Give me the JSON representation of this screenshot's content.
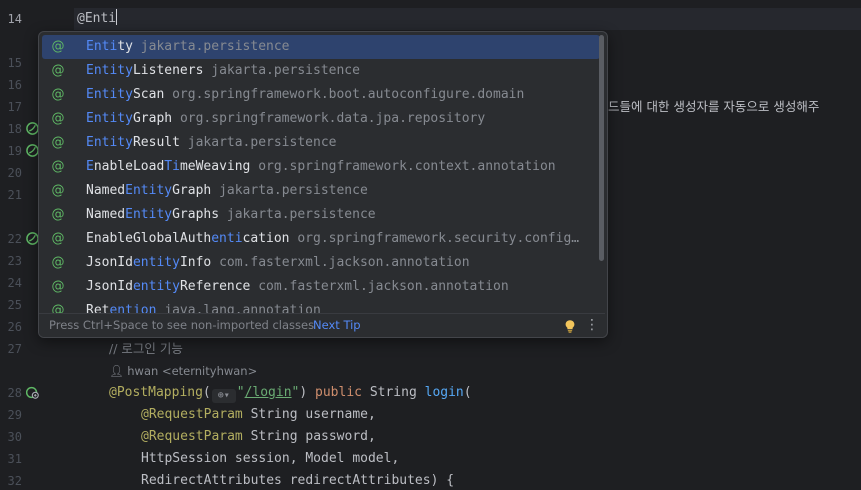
{
  "editor": {
    "current_line": {
      "number": "14",
      "text": "@Enti"
    },
    "line_numbers": {
      "l15": "15",
      "l16": "16",
      "l17": "17",
      "l18": "18",
      "l19": "19",
      "l20": "20",
      "l21": "21",
      "l22": "22",
      "l23": "23",
      "l24": "24",
      "l25": "25",
      "l26": "26",
      "l27": "27",
      "l28": "28",
      "l29": "29",
      "l30": "30",
      "l31": "31",
      "l32": "32"
    },
    "line17_tail": "드들에 대한 생성자를 자동으로 생성해주",
    "line27_comment": "// 로그인 기능",
    "author_hint": "hwan <eternityhwan>",
    "line28": {
      "annotation": "@PostMapping",
      "open": "(",
      "globe": "⊕",
      "dropdown": "▾",
      "string_quote_open": "\"",
      "path": "/login",
      "string_quote_close": "\"",
      "close": ") ",
      "kw_public": "public",
      "type": " String ",
      "method": "login",
      "paren": "("
    },
    "line29": {
      "annotation": "@RequestParam",
      "rest": " String username,"
    },
    "line30": {
      "annotation": "@RequestParam",
      "rest": " String password,"
    },
    "line31": {
      "text": "HttpSession session, Model model,"
    },
    "line32": {
      "text": "RedirectAttributes redirectAttributes) {"
    }
  },
  "completion": {
    "items": [
      {
        "icon": "@",
        "match": "Enti",
        "rest": "ty",
        "pkg": "jakarta.persistence"
      },
      {
        "icon": "@",
        "match": "Entity",
        "rest": "Listeners",
        "pkg": "jakarta.persistence"
      },
      {
        "icon": "@",
        "match": "Entity",
        "rest": "Scan",
        "pkg": "org.springframework.boot.autoconfigure.domain"
      },
      {
        "icon": "@",
        "match": "Entity",
        "rest": "Graph",
        "pkg": "org.springframework.data.jpa.repository"
      },
      {
        "icon": "@",
        "match": "Entity",
        "rest": "Result",
        "pkg": "jakarta.persistence"
      },
      {
        "icon": "@",
        "p1": "E",
        "p2": "nableLoad",
        "p3": "Ti",
        "p4": "meWeaving",
        "pkg": "org.springframework.context.annotation"
      },
      {
        "icon": "@",
        "pre": "Named",
        "match": "Entity",
        "rest": "Graph",
        "pkg": "jakarta.persistence"
      },
      {
        "icon": "@",
        "pre": "Named",
        "match": "Entity",
        "rest": "Graphs",
        "pkg": "jakarta.persistence"
      },
      {
        "icon": "@",
        "pre": "EnableGlobalAuth",
        "match": "enti",
        "rest": "cation",
        "pkg": "org.springframework.security.config…"
      },
      {
        "icon": "@",
        "pre": "JsonId",
        "match": "entity",
        "rest": "Info",
        "pkg": "com.fasterxml.jackson.annotation"
      },
      {
        "icon": "@",
        "pre": "JsonId",
        "match": "entity",
        "rest": "Reference",
        "pkg": "com.fasterxml.jackson.annotation"
      },
      {
        "icon": "@",
        "pre": "Ret",
        "match": "ention",
        "rest": "",
        "pkg": "java.lang.annotation"
      }
    ],
    "footer_text": "Press Ctrl+Space to see non-imported classes",
    "next_tip_label": "Next Tip",
    "more_icon": "⋮"
  },
  "colors": {
    "background": "#1e1f22",
    "popup_bg": "#2b2d30",
    "selection": "#2e436e",
    "match_highlight": "#548af7",
    "annotation": "#b3ae60",
    "keyword": "#cf8e6d",
    "method": "#56a8f5",
    "string": "#6aab73",
    "comment": "#7a7e85",
    "icon_green": "#5fb865"
  },
  "icons": {
    "completion_item": "annotation-at-icon",
    "gutter_spring_bean": "spring-bean-icon",
    "gutter_web_endpoint": "web-endpoint-icon",
    "footer_bulb": "lightbulb-icon",
    "footer_more": "more-vertical-icon",
    "inline_hint": "globe-icon"
  }
}
